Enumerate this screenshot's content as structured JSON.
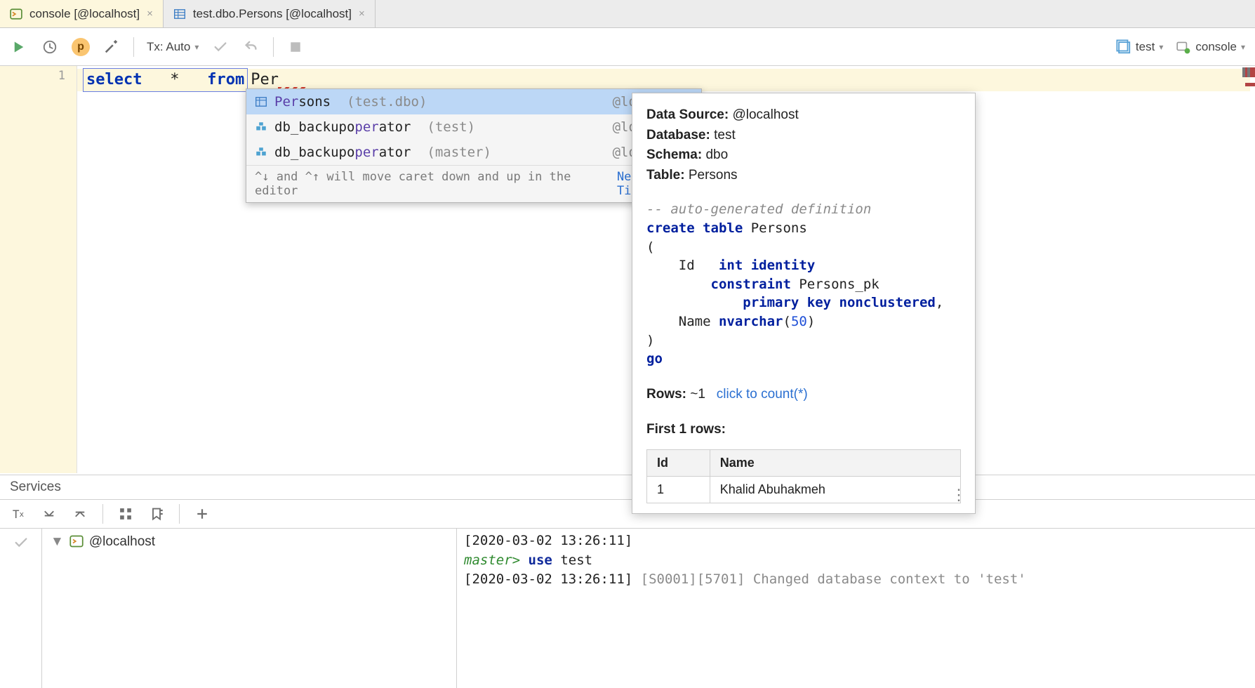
{
  "tabs": [
    {
      "label": "console [@localhost]",
      "active": true
    },
    {
      "label": "test.dbo.Persons [@localhost]",
      "active": false
    }
  ],
  "toolbar": {
    "tx_label": "Tx: Auto",
    "badge_letter": "p",
    "right_db": "test",
    "right_console": "console"
  },
  "editor": {
    "line_no": "1",
    "code_kw_select": "select",
    "code_star": "*",
    "code_kw_from": "from",
    "code_typed": "Per"
  },
  "autocomplete": {
    "items": [
      {
        "match": "Per",
        "rest": "sons",
        "hint": "(test.dbo)",
        "loc": "@localhost",
        "type": "table"
      },
      {
        "pre": "db_backupo",
        "match": "per",
        "rest": "ator",
        "hint": "(test)",
        "loc": "@localhost",
        "type": "role"
      },
      {
        "pre": "db_backupo",
        "match": "per",
        "rest": "ator",
        "hint": "(master)",
        "loc": "@localhost",
        "type": "role"
      }
    ],
    "footer_hint": "^↓ and ^↑ will move caret down and up in the editor",
    "footer_next_tip": "Next Tip"
  },
  "info": {
    "meta": {
      "data_source_label": "Data Source:",
      "data_source_value": "@localhost",
      "database_label": "Database:",
      "database_value": "test",
      "schema_label": "Schema:",
      "schema_value": "dbo",
      "table_label": "Table:",
      "table_value": "Persons"
    },
    "ddl_comment": "-- auto-generated definition",
    "ddl_create": "create table",
    "ddl_table": "Persons",
    "ddl_open": "(",
    "ddl_col1_name": "Id",
    "ddl_col1_type": "int identity",
    "ddl_constraint": "constraint",
    "ddl_constraint_name": "Persons_pk",
    "ddl_pk": "primary key nonclustered",
    "ddl_comma": ",",
    "ddl_col2_name": "Name",
    "ddl_col2_type_kw": "nvarchar",
    "ddl_col2_len": "50",
    "ddl_close": ")",
    "ddl_go": "go",
    "rows_label": "Rows:",
    "rows_value": "~1",
    "rows_link": "click to count(*)",
    "preview_label": "First 1 rows:",
    "table": {
      "cols": [
        "Id",
        "Name"
      ],
      "rows": [
        [
          "1",
          "Khalid Abuhakmeh"
        ]
      ]
    }
  },
  "services": {
    "title": "Services",
    "tree_node": "@localhost",
    "log": {
      "line1_ts": "[2020-03-02 13:26:11]",
      "line2_prompt": "master>",
      "line2_kw": "use",
      "line2_arg": "test",
      "line3_ts": "[2020-03-02 13:26:11]",
      "line3_cut": "[S0001][5701] Changed database context to 'test'"
    }
  }
}
